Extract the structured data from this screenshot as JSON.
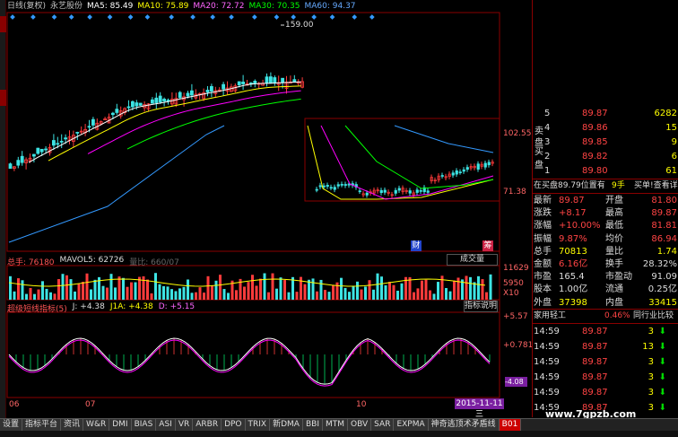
{
  "header": {
    "period": "日线(复权)",
    "stock": "永艺股份",
    "ma5": "MA5: 85.49",
    "ma10": "MA10: 75.89",
    "ma20": "MA20: 72.72",
    "ma30": "MA30: 70.35",
    "ma60": "MA60: 94.37"
  },
  "colors": {
    "up": "#ff3b3b",
    "down": "#3de3e3",
    "ma5": "#ffffff",
    "ma10": "#ffff00",
    "ma20": "#ff00ff",
    "ma30": "#00ff00",
    "ma60": "#3399ff"
  },
  "price_labels": {
    "peak": "159.00",
    "p1": "102.55",
    "p2": "71.38"
  },
  "badges": {
    "cai": "财",
    "chou": "筹"
  },
  "volume": {
    "total": "总手: 76180",
    "mavol": "MAVOL5: 62726",
    "extra": "量比: 660/07",
    "button": "成交量",
    "scale1": "11629",
    "scale2": "5950",
    "unit": "X10"
  },
  "indicator": {
    "name": "超级短线指标(5)",
    "j": "J: +4.38",
    "j1a": "J1A: +4.38",
    "d": "D: +5.15",
    "button": "指标说明",
    "s1": "+5.57",
    "s2": "+0.781",
    "s3": "-4.08"
  },
  "dates": {
    "d1": "06",
    "d2": "07",
    "d3": "10",
    "badge": "2015-11-11三"
  },
  "order_book": {
    "sell_label": "卖盘",
    "buy_label": "买盘",
    "asks": [
      {
        "level": "5",
        "price": "89.87",
        "vol": "6282"
      },
      {
        "level": "4",
        "price": "89.86",
        "vol": "15"
      },
      {
        "level": "3",
        "price": "89.85",
        "vol": "9"
      },
      {
        "level": "2",
        "price": "89.82",
        "vol": "6"
      },
      {
        "level": "1",
        "price": "89.80",
        "vol": "61"
      }
    ]
  },
  "info": {
    "line1": "在买盘89.79位置有",
    "line1b": "9手",
    "line1c": "买单!查看详细",
    "rows": [
      {
        "k1": "最新",
        "v1": "89.87",
        "k2": "开盘",
        "v2": "81.80"
      },
      {
        "k1": "涨跌",
        "v1": "+8.17",
        "k2": "最高",
        "v2": "89.87"
      },
      {
        "k1": "涨幅",
        "v1": "+10.00%",
        "k2": "最低",
        "v2": "81.81"
      },
      {
        "k1": "振幅",
        "v1": "9.87%",
        "k2": "均价",
        "v2": "86.94"
      },
      {
        "k1": "总手",
        "v1": "70813",
        "k2": "量比",
        "v2": "1.74"
      },
      {
        "k1": "金额",
        "v1": "6.16亿",
        "k2": "换手",
        "v2": "28.32%"
      },
      {
        "k1": "市盈",
        "v1": "165.4",
        "k2": "市盈动",
        "v2": "91.09"
      },
      {
        "k1": "股本",
        "v1": "1.00亿",
        "k2": "流通",
        "v2": "0.25亿"
      },
      {
        "k1": "外盘",
        "v1": "37398",
        "k2": "内盘",
        "v2": "33415"
      }
    ]
  },
  "sector": {
    "name": "家用轻工",
    "pct": "0.46%",
    "link": "同行业比较"
  },
  "trades": [
    {
      "time": "14:59",
      "price": "89.87",
      "vol": "3"
    },
    {
      "time": "14:59",
      "price": "89.87",
      "vol": "13"
    },
    {
      "time": "14:59",
      "price": "89.87",
      "vol": "3"
    },
    {
      "time": "14:59",
      "price": "89.87",
      "vol": "3"
    },
    {
      "time": "14:59",
      "price": "89.87",
      "vol": "3"
    },
    {
      "time": "14:59",
      "price": "89.87",
      "vol": "3"
    }
  ],
  "tabs": [
    "设置",
    "指标平台",
    "资讯",
    "W&R",
    "DMI",
    "BIAS",
    "ASI",
    "VR",
    "ARBR",
    "DPO",
    "TRIX",
    "新DMA",
    "BBI",
    "MTM",
    "OBV",
    "SAR",
    "EXPMA",
    "神奇逃顶术矛盾线",
    "B01"
  ],
  "watermark": "www.7gpzb.com"
}
